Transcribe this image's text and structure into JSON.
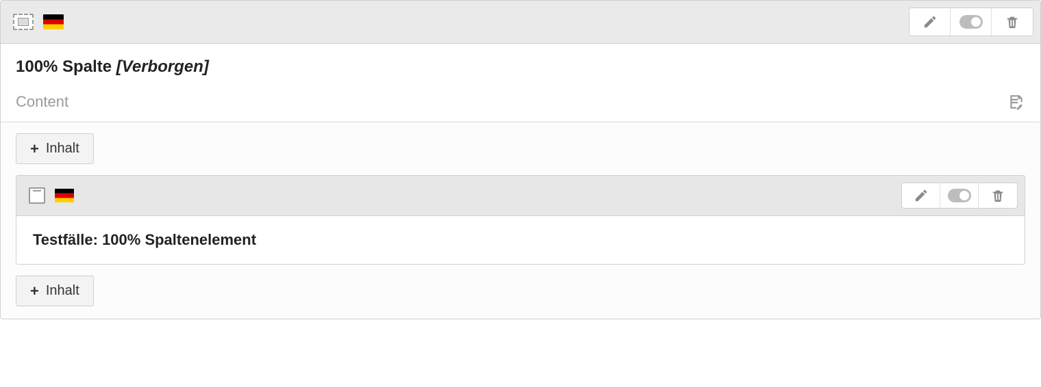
{
  "outer": {
    "title": "100% Spalte",
    "hidden_badge": "[Verborgen]",
    "content_label": "Content"
  },
  "buttons": {
    "add_content": "Inhalt"
  },
  "nested": {
    "title": "Testfälle: 100% Spaltenelement"
  }
}
